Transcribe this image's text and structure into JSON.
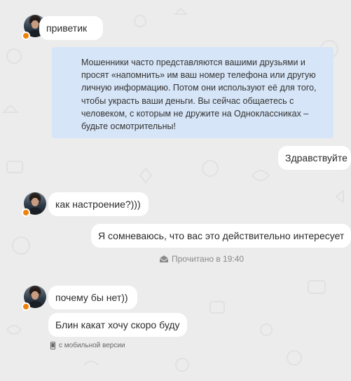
{
  "messages": {
    "m1": "приветик",
    "notice": "Мошенники часто представляются вашими друзьями и просят «напомнить» им ваш номер телефона или другую личную информацию. Потом они используют её для того, чтобы украсть ваши деньги. Вы сейчас общаетесь с человеком, с которым не дружите на Одноклассниках – будьте осмотрительны!",
    "m2": "Здравствуйте",
    "m3": "как настроение?)))",
    "m4": "Я сомневаюсь, что вас это действительно интересует",
    "m5": "почему бы нет))",
    "m6": "Блин какат хочу скоро буду"
  },
  "status": {
    "read": "Прочитано в 19:40",
    "mobile": "с мобильной версии"
  },
  "icons": {
    "read": "envelope-icon",
    "mobile": "phone-icon"
  },
  "colors": {
    "background": "#ececec",
    "notice_bg": "#d6e5f7",
    "online_dot": "#ee8208"
  }
}
